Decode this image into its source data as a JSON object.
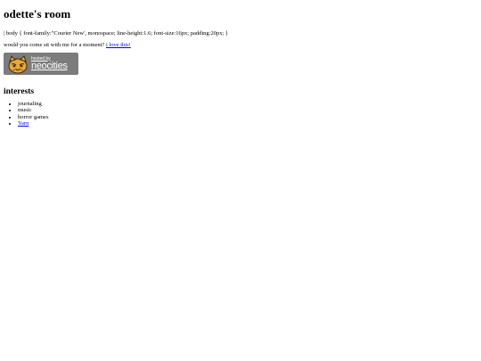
{
  "page": {
    "title": "odette's room",
    "code_line": "| body { font-family:\"Courier New', monospace; line-height:1.6; font-size:16px; padding:20px; }",
    "visit_prompt": "would you come sit with me for a moment?",
    "visit_link": "i love this!"
  },
  "badge": {
    "small_text": "hosted by",
    "big_text": "neocities",
    "icon": "neocities-cat-icon",
    "background_color": "#7c7c7c"
  },
  "interests": {
    "heading": "interests",
    "items": [
      "journaling",
      "music",
      "horror games"
    ],
    "link_item": "Yarn"
  },
  "colors": {
    "link": "#0000ee",
    "text": "#000000",
    "background": "#ffffff"
  }
}
